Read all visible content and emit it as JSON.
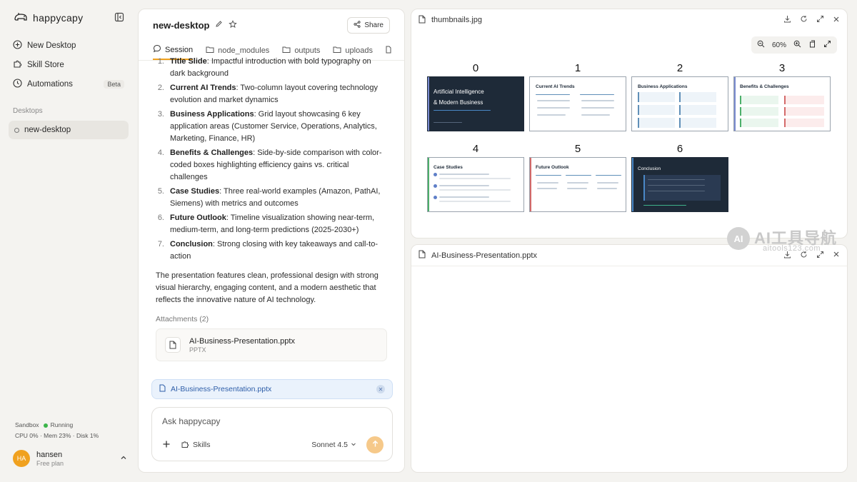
{
  "app": {
    "name": "happycapy"
  },
  "sidebar": {
    "items": [
      {
        "label": "New Desktop",
        "icon": "plus-circle-icon"
      },
      {
        "label": "Skill Store",
        "icon": "puzzle-icon"
      },
      {
        "label": "Automations",
        "icon": "clock-icon",
        "badge": "Beta"
      }
    ],
    "section_label": "Desktops",
    "desktops": [
      {
        "label": "new-desktop"
      }
    ],
    "sandbox": {
      "label": "Sandbox",
      "status": "Running",
      "stats": "CPU 0% · Mem 23% · Disk 1%"
    },
    "user": {
      "initials": "HA",
      "name": "hansen",
      "plan": "Free plan"
    }
  },
  "session": {
    "title": "new-desktop",
    "share_label": "Share",
    "tabs": [
      {
        "label": "Session",
        "active": true
      },
      {
        "label": "node_modules"
      },
      {
        "label": "outputs"
      },
      {
        "label": "uploads"
      }
    ],
    "first_item": {
      "num": "1.",
      "bold": "Title Slide",
      "text": ": Impactful introduction with bold typography on",
      "cont": "dark background"
    },
    "items": [
      {
        "num": "2.",
        "bold": "Current AI Trends",
        "text": ": Two-column layout covering technology evolution and market dynamics"
      },
      {
        "num": "3.",
        "bold": "Business Applications",
        "text": ": Grid layout showcasing 6 key application areas (Customer Service, Operations, Analytics, Marketing, Finance, HR)"
      },
      {
        "num": "4.",
        "bold": "Benefits & Challenges",
        "text": ": Side-by-side comparison with color-coded boxes highlighting efficiency gains vs. critical challenges"
      },
      {
        "num": "5.",
        "bold": "Case Studies",
        "text": ": Three real-world examples (Amazon, PathAI, Siemens) with metrics and outcomes"
      },
      {
        "num": "6.",
        "bold": "Future Outlook",
        "text": ": Timeline visualization showing near-term, medium-term, and long-term predictions (2025-2030+)"
      },
      {
        "num": "7.",
        "bold": "Conclusion",
        "text": ": Strong closing with key takeaways and call-to-action"
      }
    ],
    "summary": "The presentation features clean, professional design with strong visual hierarchy, engaging content, and a modern aesthetic that reflects the innovative nature of AI technology.",
    "attachments_label": "Attachments (2)",
    "attachment": {
      "name": "AI-Business-Presentation.pptx",
      "type": "PPTX"
    },
    "chip_label": "AI-Business-Presentation.pptx",
    "input": {
      "placeholder": "Ask happycapy",
      "skills_label": "Skills",
      "model": "Sonnet 4.5"
    }
  },
  "viewer_top": {
    "filename": "thumbnails.jpg",
    "zoom": "60%",
    "slides": [
      {
        "index": "0",
        "title": "Artificial Intelligence",
        "title2": "& Modern Business",
        "dark": true
      },
      {
        "index": "1",
        "title": "Current AI Trends"
      },
      {
        "index": "2",
        "title": "Business Applications"
      },
      {
        "index": "3",
        "title": "Benefits & Challenges"
      },
      {
        "index": "4",
        "title": "Case Studies"
      },
      {
        "index": "5",
        "title": "Future Outlook"
      },
      {
        "index": "6",
        "title": "Conclusion",
        "dark": true
      }
    ]
  },
  "viewer_bottom": {
    "filename": "AI-Business-Presentation.pptx"
  },
  "watermark": {
    "main": "AI工具导航",
    "sub": "aitools123.com"
  },
  "colors": {
    "accent": "#f0a11f",
    "running": "#3bb54a",
    "chip_text": "#2d5da8"
  }
}
